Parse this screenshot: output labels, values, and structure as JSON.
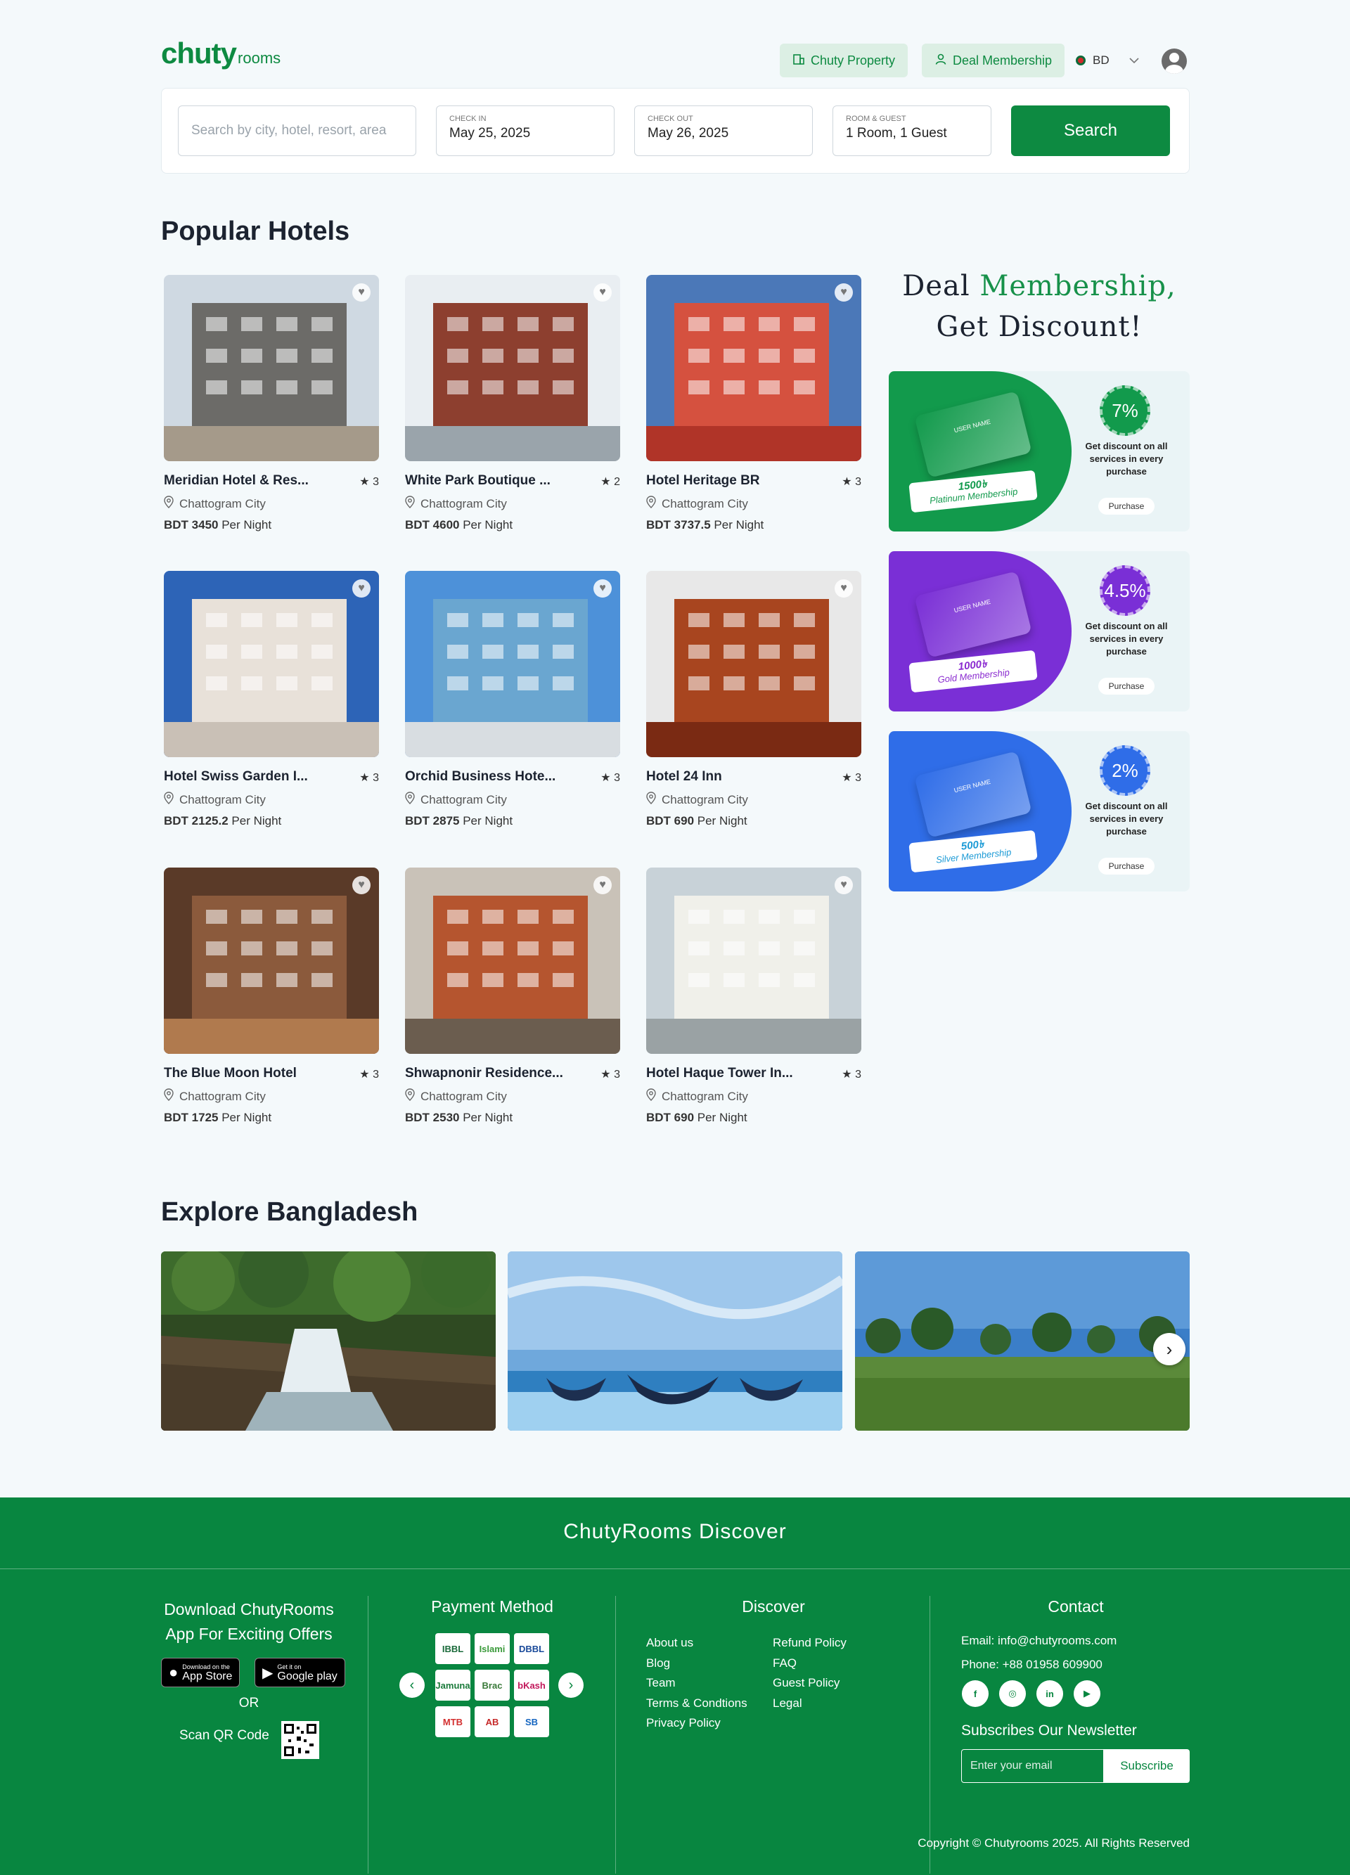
{
  "header": {
    "logo_main": "chuty",
    "logo_sub": "rooms",
    "property_label": "Chuty Property",
    "membership_label": "Deal Membership",
    "lang": "BD"
  },
  "search": {
    "placeholder": "Search by city, hotel, resort, area",
    "checkin_label": "CHECK IN",
    "checkin_value": "May 25, 2025",
    "checkout_label": "CHECK OUT",
    "checkout_value": "May 26, 2025",
    "guest_label": "ROOM & GUEST",
    "guest_value": "1 Room, 1 Guest",
    "button": "Search"
  },
  "popular": {
    "title": "Popular Hotels",
    "per_night": "Per Night",
    "hotels": [
      {
        "name": "Meridian Hotel & Res...",
        "rating": "3",
        "location": "Chattogram City",
        "price": "BDT 3450"
      },
      {
        "name": "White Park Boutique ...",
        "rating": "2",
        "location": "Chattogram City",
        "price": "BDT 4600"
      },
      {
        "name": "Hotel Heritage BR",
        "rating": "3",
        "location": "Chattogram City",
        "price": "BDT 3737.5"
      },
      {
        "name": "Hotel Swiss Garden I...",
        "rating": "3",
        "location": "Chattogram City",
        "price": "BDT 2125.2"
      },
      {
        "name": "Orchid Business Hote...",
        "rating": "3",
        "location": "Chattogram City",
        "price": "BDT 2875"
      },
      {
        "name": "Hotel 24 Inn",
        "rating": "3",
        "location": "Chattogram City",
        "price": "BDT 690"
      },
      {
        "name": "The Blue Moon Hotel",
        "rating": "3",
        "location": "Chattogram City",
        "price": "BDT 1725"
      },
      {
        "name": "Shwapnonir Residence...",
        "rating": "3",
        "location": "Chattogram City",
        "price": "BDT 2530"
      },
      {
        "name": "Hotel Haque Tower In...",
        "rating": "3",
        "location": "Chattogram City",
        "price": "BDT 690"
      }
    ]
  },
  "membership": {
    "title_a": "Deal",
    "title_b": "Membership,",
    "title_c": "Get Discount!",
    "card_user": "USER NAME",
    "desc": "Get discount on all services in every purchase",
    "purchase": "Purchase",
    "tiers": [
      {
        "discount": "7%",
        "price": "1500৳",
        "name": "Platinum Membership",
        "color": "#129a4c",
        "text_color": "#129a4c"
      },
      {
        "discount": "4.5%",
        "price": "1000৳",
        "name": "Gold Membership",
        "color": "#7a2fd6",
        "text_color": "#8a2bd0"
      },
      {
        "discount": "2%",
        "price": "500৳",
        "name": "Silver Membership",
        "color": "#2f6de8",
        "text_color": "#1d9bd6"
      }
    ]
  },
  "explore": {
    "title": "Explore Bangladesh"
  },
  "footer": {
    "title": "ChutyRooms Discover",
    "download_l1": "Download ChutyRooms",
    "download_l2": "App For Exciting Offers",
    "appstore_small": "Download on the",
    "appstore_big": "App Store",
    "gplay_small": "Get it on",
    "gplay_big": "Google play",
    "or": "OR",
    "scan": "Scan QR Code",
    "payment_title": "Payment Method",
    "payment_logos": [
      "IBBL",
      "Islami",
      "DBBL",
      "Jamuna",
      "Brac",
      "bKash",
      "MTB",
      "AB",
      "SB"
    ],
    "discover_title": "Discover",
    "links_left": [
      "About us",
      "Blog",
      "Team",
      "Terms & Condtions",
      "Privacy Policy"
    ],
    "links_right": [
      "Refund Policy",
      "FAQ",
      "Guest Policy",
      "Legal"
    ],
    "contact_title": "Contact",
    "email": "Email: info@chutyrooms.com",
    "phone": "Phone: +88 01958 609900",
    "newsletter_title": "Subscribes Our Newsletter",
    "newsletter_placeholder": "Enter your email",
    "subscribe": "Subscribe",
    "copyright": "Copyright © Chutyrooms 2025. All Rights Reserved"
  }
}
